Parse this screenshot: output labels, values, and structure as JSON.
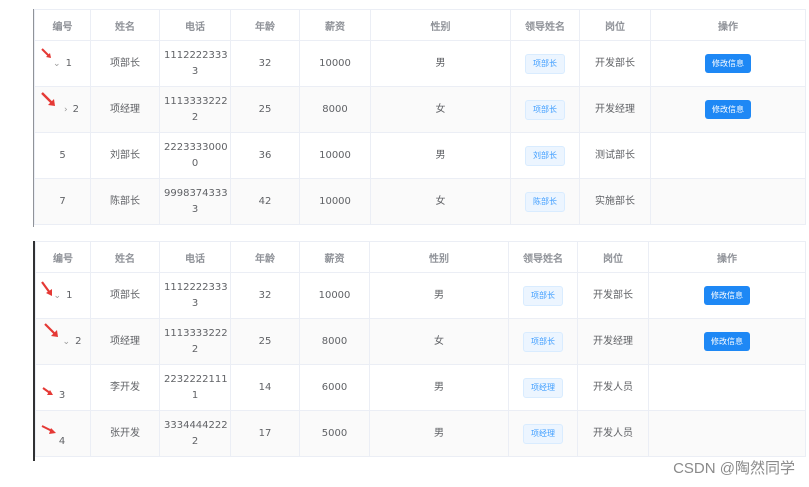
{
  "headers": [
    "编号",
    "姓名",
    "电话",
    "年龄",
    "薪资",
    "性别",
    "领导姓名",
    "岗位",
    "操作"
  ],
  "table1": {
    "rows": [
      {
        "id": "1",
        "toggle": "⌄",
        "name": "项部长",
        "phone1": "1112222333",
        "phone2": "3",
        "age": "32",
        "salary": "10000",
        "gender": "男",
        "leader": "项部长",
        "position": "开发部长",
        "action": "修改信息"
      },
      {
        "id": "2",
        "toggle": "›",
        "name": "项经理",
        "phone1": "1113333222",
        "phone2": "2",
        "age": "25",
        "salary": "8000",
        "gender": "女",
        "leader": "项部长",
        "position": "开发经理",
        "action": "修改信息"
      },
      {
        "id": "5",
        "toggle": "",
        "name": "刘部长",
        "phone1": "2223333000",
        "phone2": "0",
        "age": "36",
        "salary": "10000",
        "gender": "男",
        "leader": "刘部长",
        "position": "测试部长",
        "action": ""
      },
      {
        "id": "7",
        "toggle": "",
        "name": "陈部长",
        "phone1": "9998374333",
        "phone2": "3",
        "age": "42",
        "salary": "10000",
        "gender": "女",
        "leader": "陈部长",
        "position": "实施部长",
        "action": ""
      }
    ]
  },
  "table2": {
    "rows": [
      {
        "id": "1",
        "toggle": "⌄",
        "name": "项部长",
        "phone1": "1112222333",
        "phone2": "3",
        "age": "32",
        "salary": "10000",
        "gender": "男",
        "leader": "项部长",
        "position": "开发部长",
        "action": "修改信息"
      },
      {
        "id": "2",
        "toggle": "⌄",
        "name": "项经理",
        "phone1": "1113333222",
        "phone2": "2",
        "age": "25",
        "salary": "8000",
        "gender": "女",
        "leader": "项部长",
        "position": "开发经理",
        "action": "修改信息"
      },
      {
        "id": "3",
        "toggle": "",
        "name": "李开发",
        "phone1": "2232222111",
        "phone2": "1",
        "age": "14",
        "salary": "6000",
        "gender": "男",
        "leader": "项经理",
        "position": "开发人员",
        "action": ""
      },
      {
        "id": "4",
        "toggle": "",
        "name": "张开发",
        "phone1": "3334444222",
        "phone2": "2",
        "age": "17",
        "salary": "5000",
        "gender": "男",
        "leader": "项经理",
        "position": "开发人员",
        "action": ""
      }
    ]
  },
  "watermark": "CSDN @陶然同学",
  "colors": {
    "arrow": "#e53935",
    "button": "#1e88f5",
    "tag_text": "#409eff"
  },
  "icons": {
    "annotation": "red-arrow-icon"
  }
}
